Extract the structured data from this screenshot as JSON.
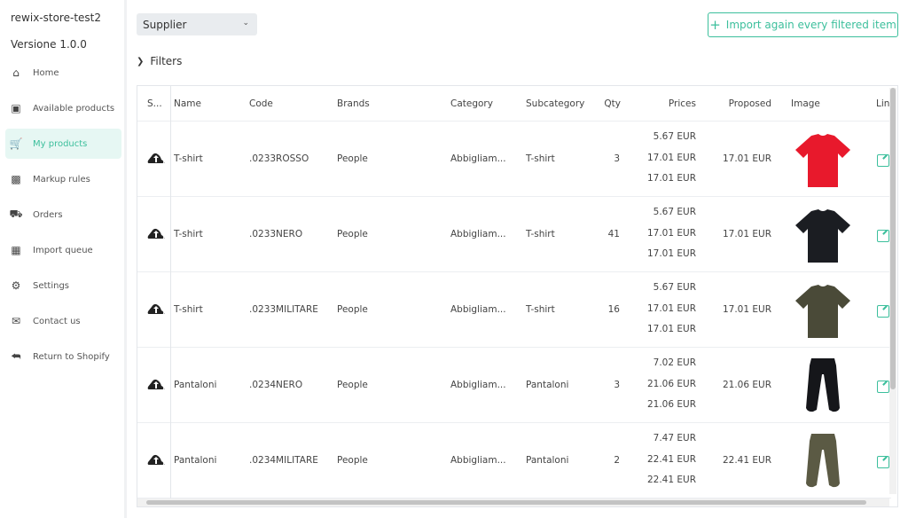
{
  "sidebar": {
    "store_name": "rewix-store-test2",
    "version": "Versione 1.0.0",
    "items": [
      {
        "label": "Home",
        "icon": "home-icon"
      },
      {
        "label": "Available products",
        "icon": "box-icon"
      },
      {
        "label": "My products",
        "icon": "cart-icon",
        "active": true
      },
      {
        "label": "Markup rules",
        "icon": "money-icon"
      },
      {
        "label": "Orders",
        "icon": "truck-icon"
      },
      {
        "label": "Import queue",
        "icon": "grid-icon"
      },
      {
        "label": "Settings",
        "icon": "gears-icon"
      },
      {
        "label": "Contact us",
        "icon": "envelope-icon"
      },
      {
        "label": "Return to Shopify",
        "icon": "return-icon"
      }
    ]
  },
  "toolbar": {
    "supplier_select": "Supplier",
    "import_button": "Import again every filtered item",
    "filters_label": "Filters"
  },
  "colors": {
    "accent": "#3cbf9c",
    "active_bg": "#e6f7f3"
  },
  "table": {
    "headers": [
      "S...",
      "Name",
      "Code",
      "Brands",
      "Category",
      "Subcategory",
      "Qty",
      "Prices",
      "Proposed",
      "Image",
      "Lin"
    ],
    "rows": [
      {
        "status_icon": "cloud-upload-icon",
        "name": "T-shirt",
        "code": ".0233ROSSO",
        "brand": "People",
        "category": "Abbigliam...",
        "subcategory": "T-shirt",
        "qty": "3",
        "prices": [
          "5.67 EUR",
          "17.01 EUR",
          "17.01 EUR"
        ],
        "proposed": "17.01 EUR",
        "image": "red t-shirt",
        "image_color": "#e8192c",
        "image_type": "tshirt"
      },
      {
        "status_icon": "cloud-upload-icon",
        "name": "T-shirt",
        "code": ".0233NERO",
        "brand": "People",
        "category": "Abbigliam...",
        "subcategory": "T-shirt",
        "qty": "41",
        "prices": [
          "5.67 EUR",
          "17.01 EUR",
          "17.01 EUR"
        ],
        "proposed": "17.01 EUR",
        "image": "black t-shirt",
        "image_color": "#1b1d22",
        "image_type": "tshirt"
      },
      {
        "status_icon": "cloud-upload-icon",
        "name": "T-shirt",
        "code": ".0233MILITARE",
        "brand": "People",
        "category": "Abbigliam...",
        "subcategory": "T-shirt",
        "qty": "16",
        "prices": [
          "5.67 EUR",
          "17.01 EUR",
          "17.01 EUR"
        ],
        "proposed": "17.01 EUR",
        "image": "military green t-shirt",
        "image_color": "#4a4a38",
        "image_type": "tshirt"
      },
      {
        "status_icon": "cloud-upload-icon",
        "name": "Pantaloni",
        "code": ".0234NERO",
        "brand": "People",
        "category": "Abbigliam...",
        "subcategory": "Pantaloni",
        "qty": "3",
        "prices": [
          "7.02 EUR",
          "21.06 EUR",
          "21.06 EUR"
        ],
        "proposed": "21.06 EUR",
        "image": "black pants",
        "image_color": "#15161a",
        "image_type": "pants"
      },
      {
        "status_icon": "cloud-upload-icon",
        "name": "Pantaloni",
        "code": ".0234MILITARE",
        "brand": "People",
        "category": "Abbigliam...",
        "subcategory": "Pantaloni",
        "qty": "2",
        "prices": [
          "7.47 EUR",
          "22.41 EUR",
          "22.41 EUR"
        ],
        "proposed": "22.41 EUR",
        "image": "military green pants",
        "image_color": "#5b5a44",
        "image_type": "pants"
      }
    ]
  }
}
